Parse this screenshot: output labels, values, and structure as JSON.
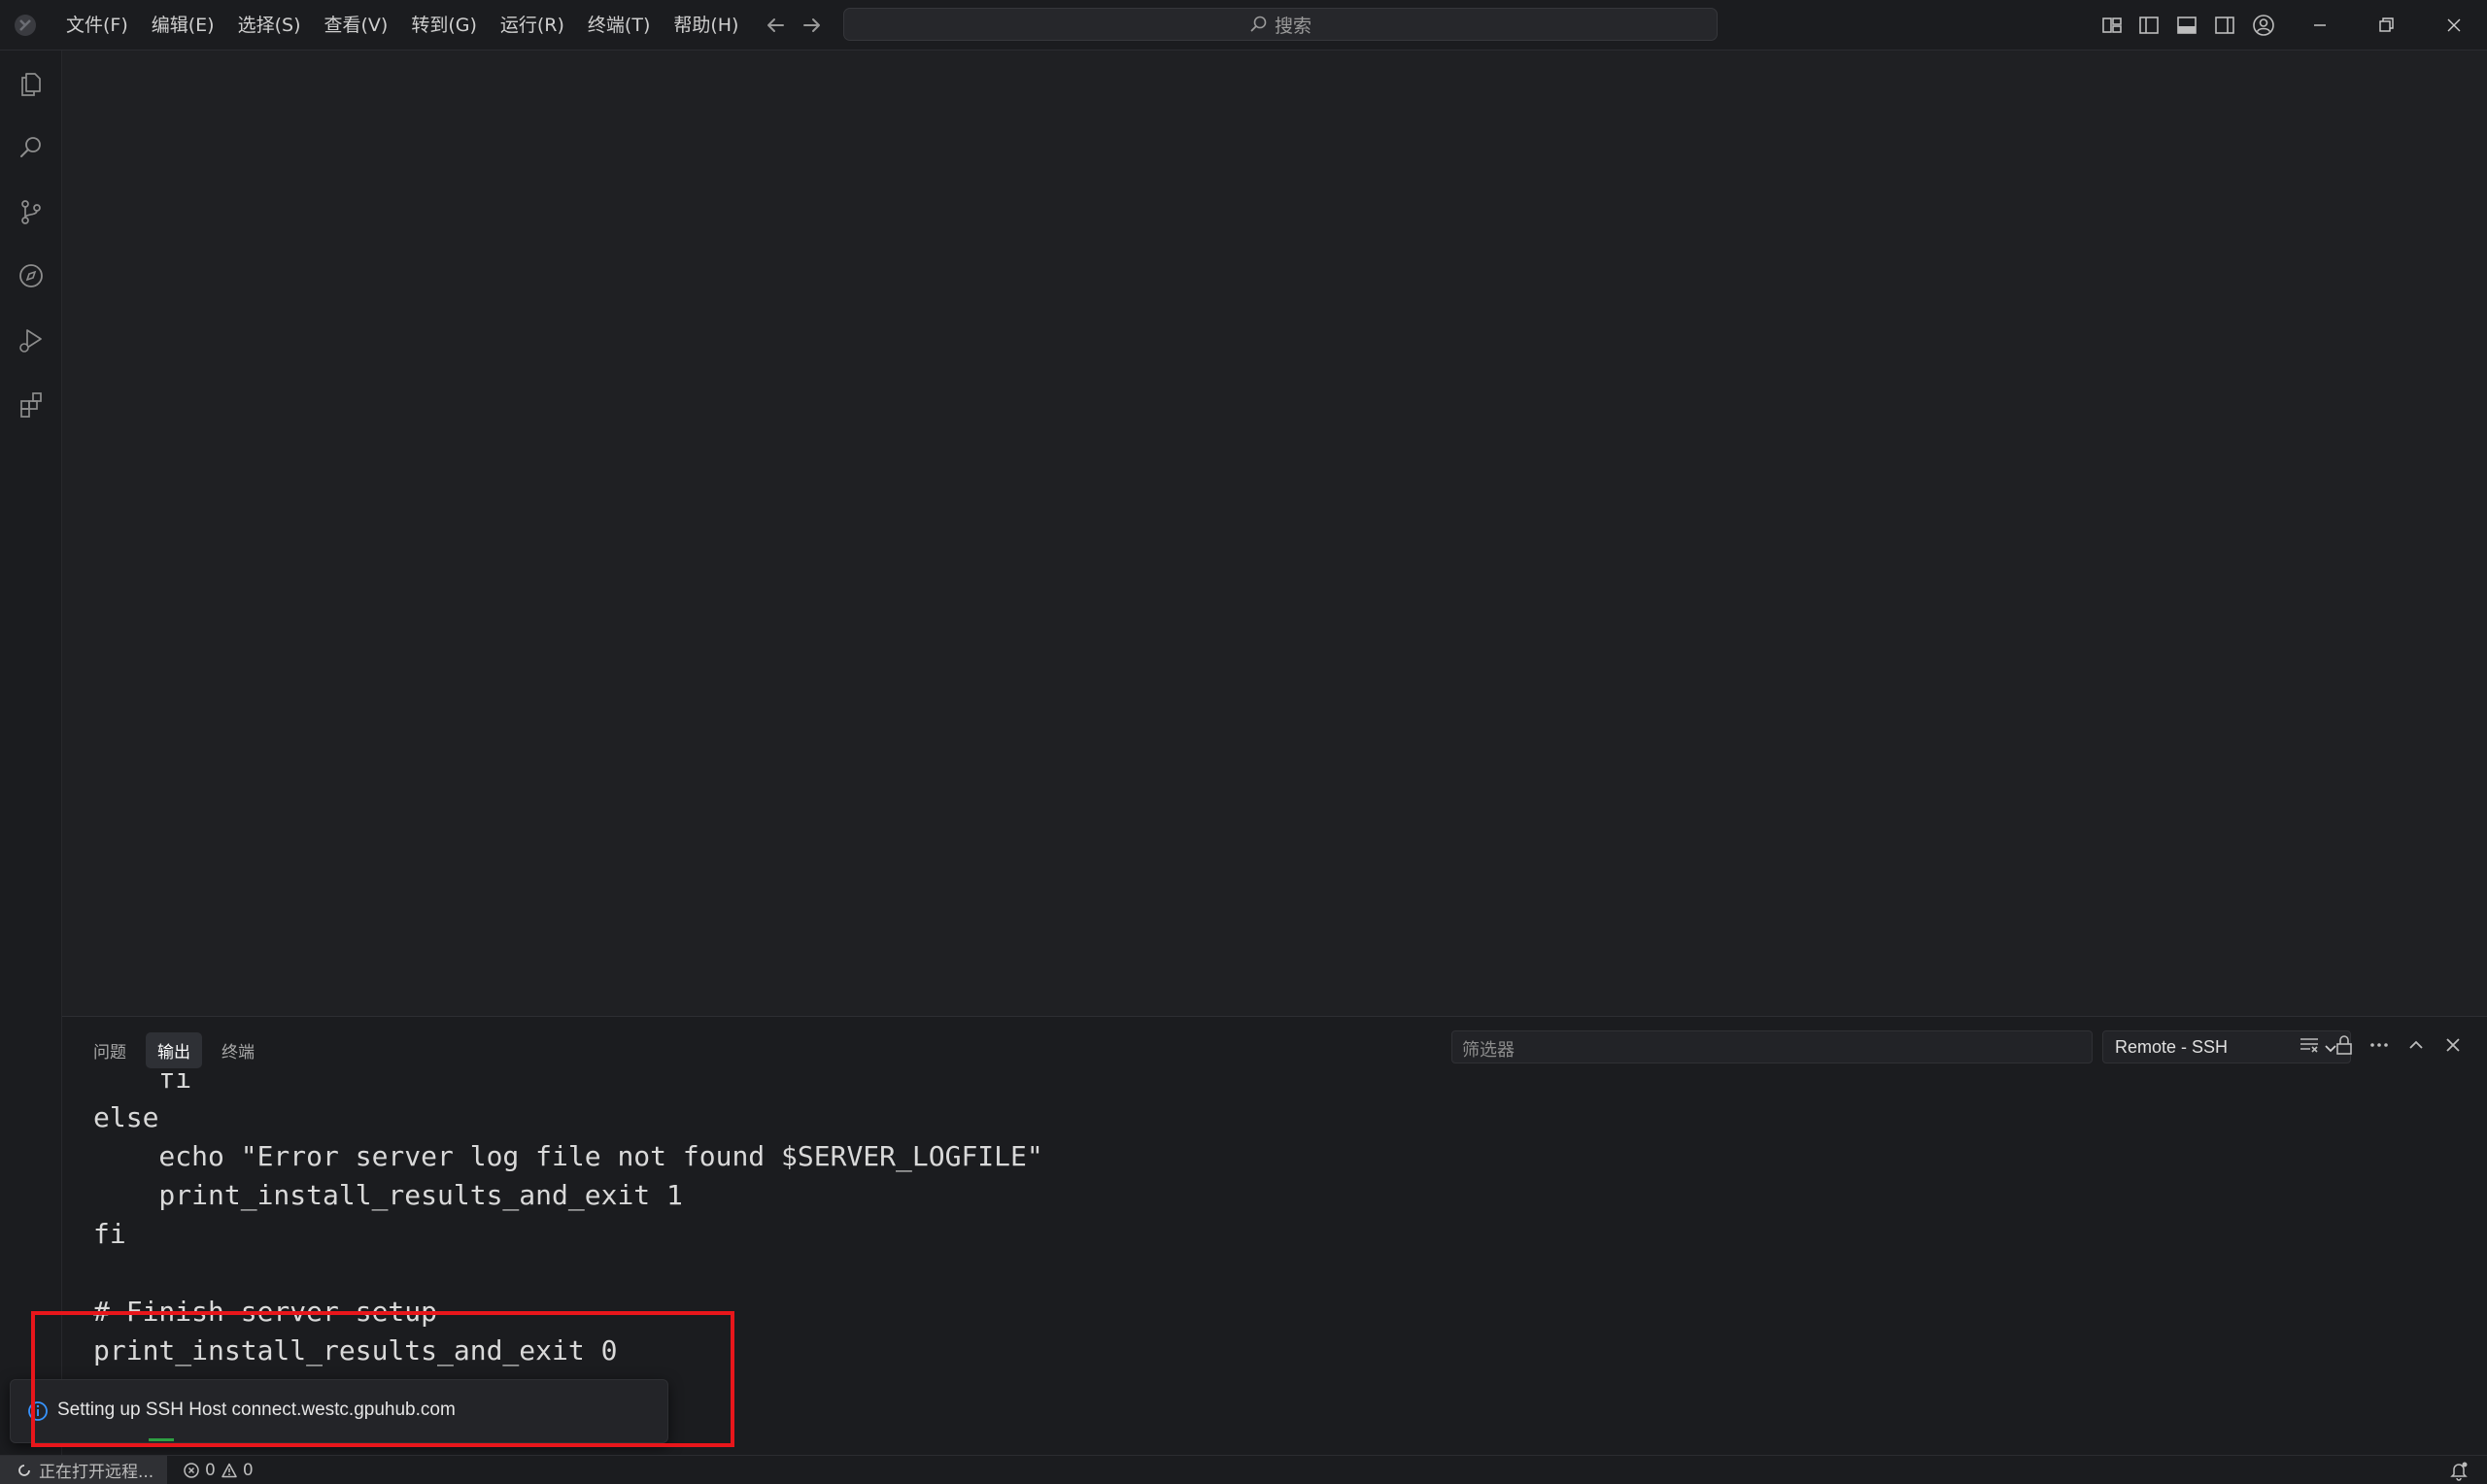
{
  "titlebar": {
    "menu": [
      "文件(F)",
      "编辑(E)",
      "选择(S)",
      "查看(V)",
      "转到(G)",
      "运行(R)",
      "终端(T)",
      "帮助(H)"
    ],
    "search_placeholder": "搜索"
  },
  "panel": {
    "tabs": [
      {
        "label": "问题",
        "active": false
      },
      {
        "label": "输出",
        "active": true
      },
      {
        "label": "终端",
        "active": false
      }
    ],
    "filter_placeholder": "筛选器",
    "output_channel": "Remote - SSH",
    "output_lines": [
      "    fi",
      "else",
      "    echo \"Error server log file not found $SERVER_LOGFILE\"",
      "    print_install_results_and_exit 1",
      "fi",
      "",
      "# Finish server setup",
      "print_install_results_and_exit 0"
    ]
  },
  "notification": {
    "icon": "info-icon",
    "message": "Setting up SSH Host connect.westc.gpuhub.com",
    "accent": "#2ea043"
  },
  "statusbar": {
    "remote_label": "正在打开远程...",
    "errors": "0",
    "warnings": "0"
  },
  "colors": {
    "highlight_border": "#e8161b",
    "background": "#1f2023"
  }
}
